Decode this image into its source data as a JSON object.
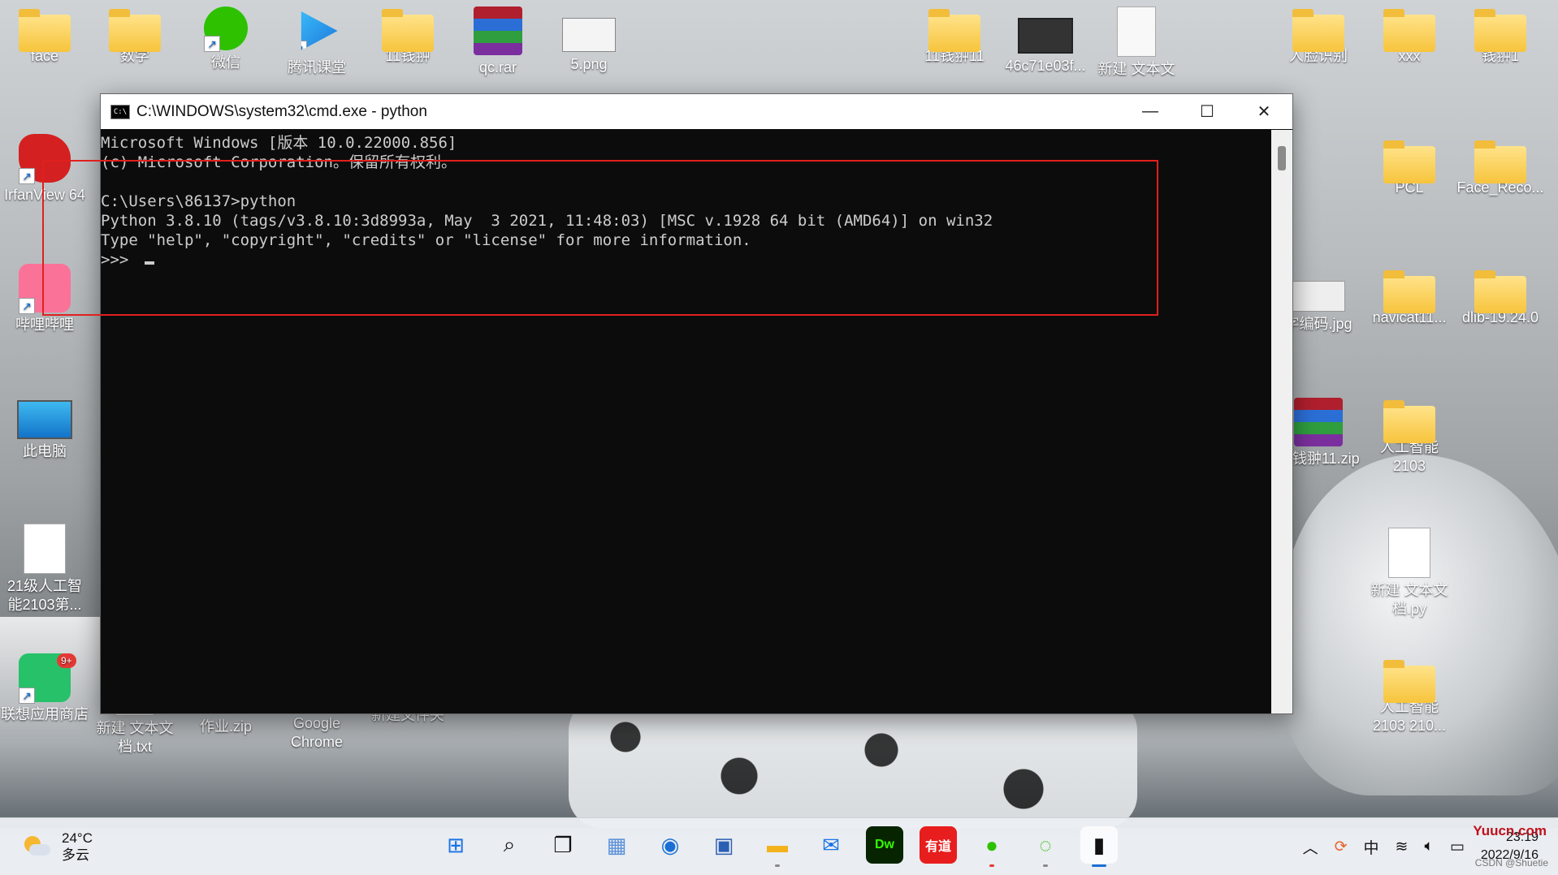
{
  "desktop": {
    "icons_top": [
      {
        "label": "face",
        "kind": "folder"
      },
      {
        "label": "数学",
        "kind": "folder"
      },
      {
        "label": "微信",
        "kind": "wechat"
      },
      {
        "label": "腾讯课堂",
        "kind": "tencent"
      },
      {
        "label": "11钱翀",
        "kind": "folder"
      },
      {
        "label": "qc.rar",
        "kind": "rar"
      },
      {
        "label": "5.png",
        "kind": "png"
      },
      {
        "label": "11钱翀11",
        "kind": "folder"
      },
      {
        "label": "46c71e03f...",
        "kind": "video"
      },
      {
        "label": "新建 文本文",
        "kind": "txt"
      },
      {
        "label": "人脸识别",
        "kind": "folder"
      },
      {
        "label": "xxx",
        "kind": "folder"
      },
      {
        "label": "钱翀1",
        "kind": "folder"
      }
    ],
    "icons_left": [
      {
        "label": "IrfanView 64",
        "kind": "irfan"
      },
      {
        "label": "哔哩哔哩",
        "kind": "bili"
      },
      {
        "label": "此电脑",
        "kind": "pc"
      },
      {
        "label": "21级人工智能2103第...",
        "kind": "excel"
      },
      {
        "label": "联想应用商店",
        "kind": "store"
      }
    ],
    "icons_bottom": [
      {
        "label": "新建 文本文档.txt",
        "kind": "txt"
      },
      {
        "label": "作业.zip",
        "kind": "zip"
      },
      {
        "label": "Google Chrome",
        "kind": "chrome"
      },
      {
        "label": "新建文件夹",
        "kind": "folder"
      }
    ],
    "icons_right": [
      {
        "label": "PCL",
        "kind": "folder"
      },
      {
        "label": "Face_Reco...",
        "kind": "folder"
      },
      {
        "label": "字编码.jpg",
        "kind": "jpg"
      },
      {
        "label": "navicat11...",
        "kind": "folder"
      },
      {
        "label": "dlib-19.24.0",
        "kind": "folder"
      },
      {
        "label": "11钱翀11.zip",
        "kind": "rar"
      },
      {
        "label": "人工智能2103",
        "kind": "folder"
      },
      {
        "label": "新建 文本文档.py",
        "kind": "py"
      },
      {
        "label": "人工智能2103 210...",
        "kind": "folder"
      }
    ],
    "store_badge": "9+"
  },
  "window": {
    "title": "C:\\WINDOWS\\system32\\cmd.exe - python",
    "minimize": "—",
    "maximize": "☐",
    "close": "✕",
    "lines": [
      "Microsoft Windows [版本 10.0.22000.856]",
      "(c) Microsoft Corporation。保留所有权利。",
      "",
      "C:\\Users\\86137>python",
      "Python 3.8.10 (tags/v3.8.10:3d8993a, May  3 2021, 11:48:03) [MSC v.1928 64 bit (AMD64)] on win32",
      "Type \"help\", \"copyright\", \"credits\" or \"license\" for more information.",
      ">>> "
    ]
  },
  "taskbar": {
    "weather_temp": "24°C",
    "weather_desc": "多云",
    "apps": [
      {
        "name": "start-icon",
        "glyph": "⊞",
        "color": "#1a73e8"
      },
      {
        "name": "search-icon",
        "glyph": "⌕",
        "color": "#111"
      },
      {
        "name": "task-view-icon",
        "glyph": "❐",
        "color": "#111"
      },
      {
        "name": "photos-icon",
        "glyph": "▦",
        "color": "#5b8fd8"
      },
      {
        "name": "lenovo-icon",
        "glyph": "◉",
        "color": "#1a6fd6"
      },
      {
        "name": "store-icon",
        "glyph": "▣",
        "color": "#2b5fb3"
      },
      {
        "name": "explorer-icon",
        "glyph": "▬",
        "color": "#f3b21b"
      },
      {
        "name": "mail-icon",
        "glyph": "✉",
        "color": "#1a73e8"
      },
      {
        "name": "dreamweaver-icon",
        "glyph": "Dw",
        "color": "#35fa00"
      },
      {
        "name": "youdao-icon",
        "glyph": "有道",
        "color": "#e81d1d"
      },
      {
        "name": "wechat-icon",
        "glyph": "●",
        "color": "#2dc100"
      },
      {
        "name": "loader-icon",
        "glyph": "◌",
        "color": "#2dc100"
      },
      {
        "name": "cmd-icon",
        "glyph": "▮",
        "color": "#000"
      }
    ],
    "ime": "中",
    "time": "23:19",
    "date": "2022/9/16",
    "watermark": "CSDN @Shuetie",
    "yuucn": "Yuucn.com"
  }
}
